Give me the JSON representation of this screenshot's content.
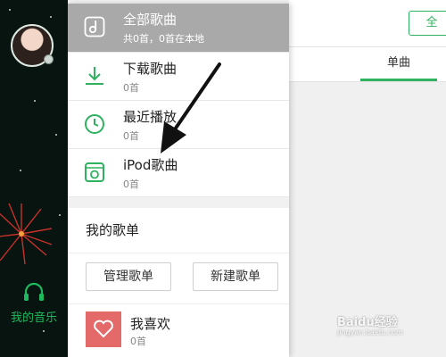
{
  "sidebar": {
    "my_music_label": "我的音乐"
  },
  "menu": {
    "items": [
      {
        "title": "全部歌曲",
        "subtitle": "共0首，0首在本地",
        "icon": "music-note-icon"
      },
      {
        "title": "下载歌曲",
        "subtitle": "0首",
        "icon": "download-icon"
      },
      {
        "title": "最近播放",
        "subtitle": "0首",
        "icon": "clock-icon"
      },
      {
        "title": "iPod歌曲",
        "subtitle": "0首",
        "icon": "ipod-icon"
      }
    ],
    "playlist_section_title": "我的歌单",
    "manage_button": "管理歌单",
    "new_button": "新建歌单",
    "favorite": {
      "title": "我喜欢",
      "subtitle": "0首",
      "icon": "heart-icon"
    }
  },
  "right": {
    "top_button": "全",
    "tab_single": "单曲"
  },
  "watermark": {
    "text": "Baidu经验",
    "sub": "jingyan.baidu.com"
  },
  "colors": {
    "accent": "#2fb25f",
    "top_item_bg": "#a9a9a9",
    "favorite_cover": "#e46a6a",
    "sidebar_bg": "#07140f"
  }
}
